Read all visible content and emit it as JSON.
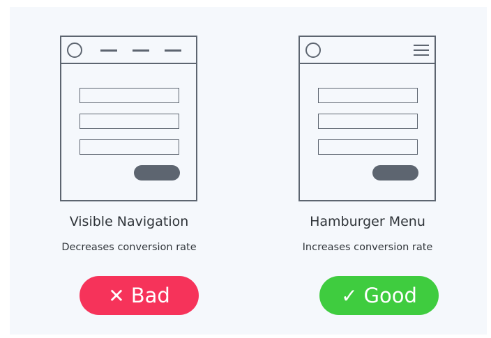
{
  "left": {
    "title": "Visible Navigation",
    "subtitle": "Decreases conversion rate",
    "badge_icon": "✕",
    "badge_label": "Bad",
    "badge_color": "#f6335a"
  },
  "right": {
    "title": "Hamburger Menu",
    "subtitle": "Increases conversion rate",
    "badge_icon": "✓",
    "badge_label": "Good",
    "badge_color": "#3fcc3f"
  },
  "colors": {
    "panel_background": "#f5f8fc",
    "wireframe": "#5d6570",
    "text": "#2f3439"
  }
}
